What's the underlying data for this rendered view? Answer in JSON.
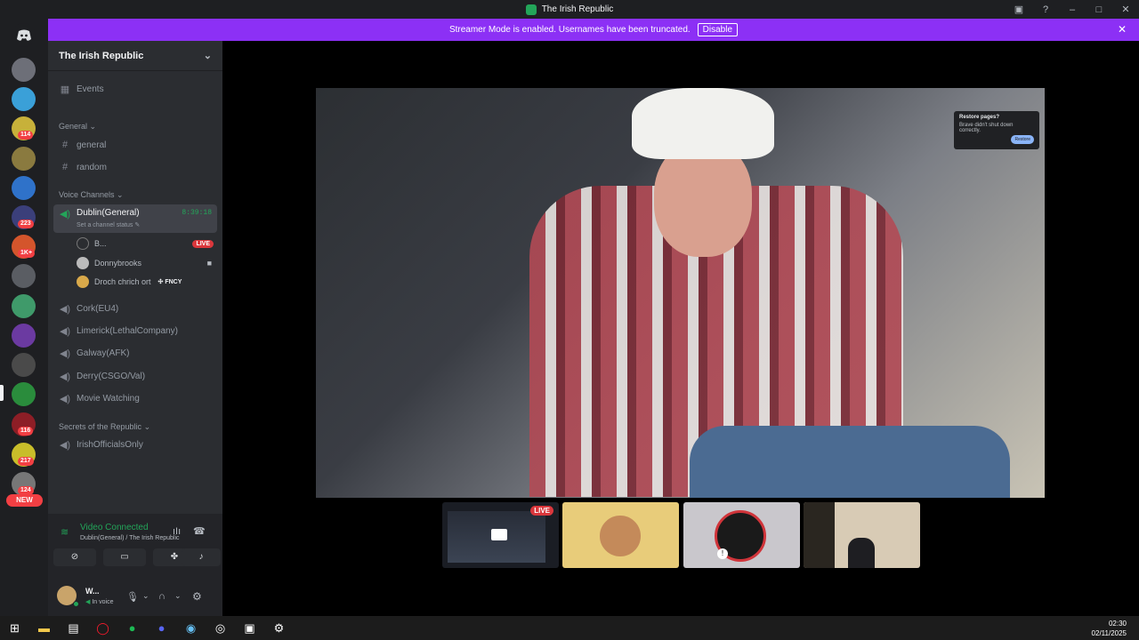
{
  "window": {
    "title": "The Irish Republic",
    "controls": [
      "minimize-icon",
      "maximize-icon",
      "close-icon"
    ]
  },
  "banner": {
    "text": "Streamer Mode is enabled. Usernames have been truncated.",
    "button": "Disable",
    "bg": "#8c30f5"
  },
  "rail": {
    "badges": [
      "114",
      "223",
      "1K+",
      "116",
      "217",
      "124"
    ],
    "new_label": "NEW"
  },
  "server": {
    "name": "The Irish Republic"
  },
  "sidebar": {
    "events": "Events",
    "categories": {
      "general": "General",
      "voice": "Voice Channels",
      "secrets": "Secrets of the Republic"
    },
    "text_channels": [
      "general",
      "random"
    ],
    "active_voice": {
      "name": "Dublin(General)",
      "timer": "8:39:18",
      "status": "Set a channel status"
    },
    "voice_users": [
      {
        "name": "B...",
        "live": "LIVE"
      },
      {
        "name": "Donnybrooks"
      },
      {
        "name": "Droch chrich ort",
        "tag": "FNCY"
      }
    ],
    "voice_channels": [
      "Cork(EU4)",
      "Limerick(LethalCompany)",
      "Galway(AFK)",
      "Derry(CSGO/Val)",
      "Movie Watching"
    ],
    "secret_channels": [
      "IrishOfficialsOnly"
    ]
  },
  "voice_panel": {
    "status": "Video Connected",
    "sub": "Dublin(General) / The Irish Republic",
    "accent": "#23a559"
  },
  "user": {
    "name": "W...",
    "status": "In voice"
  },
  "stage": {
    "popup_title": "Restore pages?",
    "popup_body": "Brave didn't shut down correctly.",
    "popup_button": "Restore"
  },
  "thumbs": [
    {
      "label": "LIVE"
    },
    {},
    {},
    {}
  ],
  "clock": {
    "time": "02:30",
    "date": "02/11/2025"
  }
}
